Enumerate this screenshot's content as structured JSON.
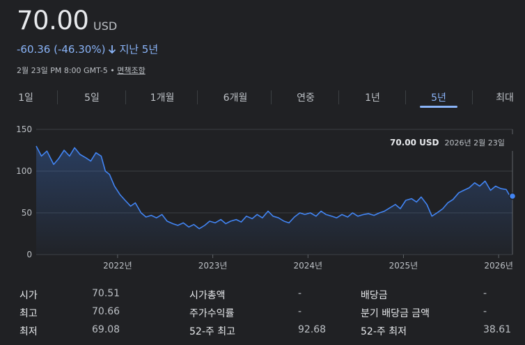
{
  "header": {
    "price": "70.00",
    "currency": "USD",
    "change": "-60.36 (-46.30%)",
    "period": "지난 5년",
    "timestamp": "2월 23일 PM 8:00 GMT-5",
    "separator": "•",
    "disclaimer": "면책조항"
  },
  "tabs": [
    {
      "label": "1일",
      "active": false
    },
    {
      "label": "5일",
      "active": false
    },
    {
      "label": "1개월",
      "active": false
    },
    {
      "label": "6개월",
      "active": false
    },
    {
      "label": "연중",
      "active": false
    },
    {
      "label": "1년",
      "active": false
    },
    {
      "label": "5년",
      "active": true
    },
    {
      "label": "최대",
      "active": false
    }
  ],
  "tooltip": {
    "value": "70.00 USD",
    "date": "2026년 2월 23일"
  },
  "colors": {
    "line": "#4285f4",
    "accent": "#8ab4f8",
    "background": "#202124",
    "grid": "#3c4043"
  },
  "chart_data": {
    "type": "area",
    "title": "",
    "xlabel": "",
    "ylabel": "",
    "ylim": [
      0,
      150
    ],
    "yticks": [
      0,
      50,
      100,
      150
    ],
    "xlim": [
      "2021-02-23",
      "2026-02-23"
    ],
    "xticks": [
      {
        "label": "2022년",
        "date": "2022-01-01"
      },
      {
        "label": "2023년",
        "date": "2023-01-01"
      },
      {
        "label": "2024년",
        "date": "2024-01-01"
      },
      {
        "label": "2025년",
        "date": "2025-01-01"
      },
      {
        "label": "2026년",
        "date": "2026-01-01"
      }
    ],
    "grid": true,
    "series": [
      {
        "x": [
          "2021-02-23",
          "2021-03-15",
          "2021-04-05",
          "2021-05-01",
          "2021-05-20",
          "2021-06-10",
          "2021-07-01",
          "2021-07-20",
          "2021-08-10",
          "2021-09-01",
          "2021-09-20",
          "2021-10-10",
          "2021-10-30",
          "2021-11-15",
          "2021-12-01",
          "2021-12-20",
          "2022-01-10",
          "2022-01-30",
          "2022-02-20",
          "2022-03-10",
          "2022-04-01",
          "2022-04-20",
          "2022-05-10",
          "2022-05-30",
          "2022-06-20",
          "2022-07-10",
          "2022-08-01",
          "2022-08-20",
          "2022-09-10",
          "2022-10-01",
          "2022-10-20",
          "2022-11-10",
          "2022-12-01",
          "2022-12-20",
          "2023-01-10",
          "2023-02-01",
          "2023-02-20",
          "2023-03-10",
          "2023-04-01",
          "2023-04-20",
          "2023-05-10",
          "2023-06-01",
          "2023-06-20",
          "2023-07-10",
          "2023-08-01",
          "2023-08-20",
          "2023-09-10",
          "2023-10-01",
          "2023-10-20",
          "2023-11-10",
          "2023-12-01",
          "2023-12-20",
          "2024-01-10",
          "2024-02-01",
          "2024-02-20",
          "2024-03-10",
          "2024-04-01",
          "2024-04-20",
          "2024-05-10",
          "2024-06-01",
          "2024-06-20",
          "2024-07-10",
          "2024-08-01",
          "2024-08-20",
          "2024-09-10",
          "2024-10-01",
          "2024-10-20",
          "2024-11-10",
          "2024-12-01",
          "2024-12-20",
          "2025-01-10",
          "2025-02-01",
          "2025-02-20",
          "2025-03-10",
          "2025-04-01",
          "2025-04-20",
          "2025-05-10",
          "2025-06-01",
          "2025-06-20",
          "2025-07-10",
          "2025-08-01",
          "2025-08-20",
          "2025-09-10",
          "2025-10-01",
          "2025-10-20",
          "2025-11-10",
          "2025-12-01",
          "2025-12-20",
          "2026-01-10",
          "2026-01-30",
          "2026-02-10",
          "2026-02-23"
        ],
        "values": [
          130,
          118,
          124,
          108,
          115,
          125,
          118,
          128,
          120,
          116,
          112,
          122,
          118,
          100,
          96,
          82,
          72,
          65,
          58,
          62,
          50,
          45,
          47,
          44,
          48,
          40,
          37,
          35,
          38,
          33,
          36,
          31,
          35,
          40,
          38,
          42,
          37,
          40,
          42,
          39,
          46,
          43,
          48,
          44,
          52,
          46,
          44,
          40,
          38,
          45,
          50,
          48,
          50,
          46,
          52,
          48,
          46,
          44,
          48,
          45,
          50,
          46,
          48,
          49,
          47,
          50,
          52,
          56,
          60,
          55,
          65,
          67,
          63,
          69,
          60,
          46,
          50,
          55,
          62,
          66,
          74,
          77,
          80,
          86,
          82,
          88,
          77,
          82,
          79,
          78,
          72,
          70
        ],
        "color": "#4285f4"
      }
    ]
  },
  "stats": [
    {
      "label": "시가",
      "value": "70.51"
    },
    {
      "label": "최고",
      "value": "70.66"
    },
    {
      "label": "최저",
      "value": "69.08"
    },
    {
      "label": "시가총액",
      "value": "-"
    },
    {
      "label": "주가수익률",
      "value": "-"
    },
    {
      "label": "52-주 최고",
      "value": "92.68"
    },
    {
      "label": "배당금",
      "value": "-"
    },
    {
      "label": "분기 배당금 금액",
      "value": "-"
    },
    {
      "label": "52-주 최저",
      "value": "38.61"
    }
  ]
}
